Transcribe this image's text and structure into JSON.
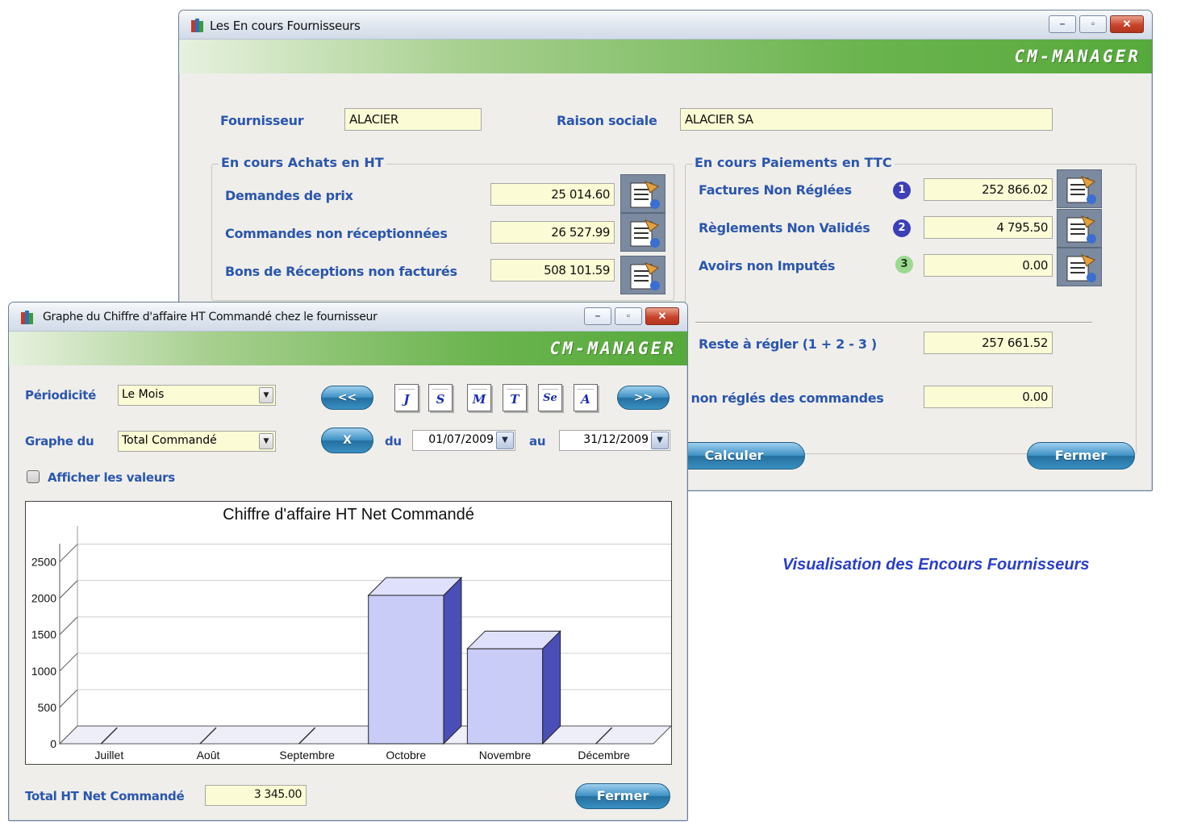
{
  "main_window": {
    "title": "Les En cours Fournisseurs",
    "brand": "CM-MANAGER",
    "fournisseur_label": "Fournisseur",
    "fournisseur_value": "ALACIER",
    "raison_label": "Raison sociale",
    "raison_value": "ALACIER  SA",
    "achats": {
      "title": "En cours Achats en HT",
      "rows": [
        {
          "label": "Demandes de prix",
          "value": "25 014.60"
        },
        {
          "label": "Commandes non réceptionnées",
          "value": "26 527.99"
        },
        {
          "label": "Bons de Réceptions non facturés",
          "value": "508 101.59"
        }
      ]
    },
    "paiements": {
      "title": "En cours Paiements en TTC",
      "rows": [
        {
          "label": "Factures Non Réglées",
          "badge": "1",
          "value": "252 866.02"
        },
        {
          "label": "Règlements Non Validés",
          "badge": "2",
          "value": "4 795.50"
        },
        {
          "label": "Avoirs non Imputés",
          "badge": "3",
          "value": "0.00"
        }
      ],
      "reste_label": "Reste à régler (1 + 2 - 3 )",
      "reste_value": "257 661.52",
      "acomptes_label": "s non réglés des commandes",
      "acomptes_value": "0.00"
    },
    "calculer_label": "Calculer",
    "fermer_label": "Fermer"
  },
  "graph_window": {
    "title": "Graphe du Chiffre d'affaire HT Commandé chez le fournisseur",
    "brand": "CM-MANAGER",
    "periodicite_label": "Périodicité",
    "periodicite_value": "Le Mois",
    "graphe_du_label": "Graphe du",
    "graphe_du_value": "Total Commandé",
    "prev_label": "<<",
    "next_label": ">>",
    "clear_label": "X",
    "period_buttons": [
      "J",
      "S",
      "M",
      "T",
      "Se",
      "A"
    ],
    "du_label": "du",
    "du_value": "01/07/2009",
    "au_label": "au",
    "au_value": "31/12/2009",
    "afficher_label": "Afficher les valeurs",
    "total_label": "Total HT Net Commandé",
    "total_value": "3 345.00",
    "fermer_label": "Fermer"
  },
  "chart_data": {
    "type": "bar",
    "title": "Chiffre d'affaire HT Net Commandé",
    "categories": [
      "Juillet",
      "Août",
      "Septembre",
      "Octobre",
      "Novembre",
      "Décembre"
    ],
    "values": [
      0,
      0,
      0,
      2040,
      1305,
      0
    ],
    "yticks": [
      0,
      500,
      1000,
      1500,
      2000,
      2500
    ],
    "ylim": [
      0,
      2750
    ],
    "grid": true,
    "bar_color": "#c9ccf6",
    "bar_side_color": "#4a4fb8"
  },
  "caption": "Visualisation des Encours Fournisseurs",
  "colors": {
    "label_blue": "#2b56ad",
    "field_yellow": "#fbfbd5",
    "brand_green": "#56a93b",
    "badge1": "#3c3fb8",
    "badge2": "#3c3fb8",
    "badge3": "#7dcf7a"
  }
}
